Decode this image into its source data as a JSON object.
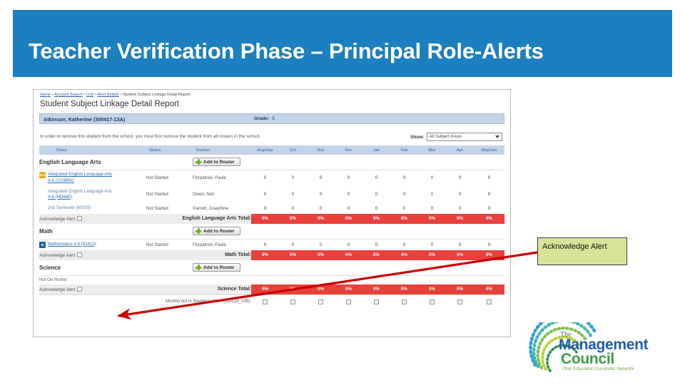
{
  "slide": {
    "title": "Teacher Verification Phase – Principal Role-Alerts",
    "banner_color": "#1c7fc0"
  },
  "screenshot": {
    "breadcrumb": {
      "items": [
        "Home",
        "Account Search",
        "Link",
        "Alert Details"
      ],
      "current": "Student Subject Linkage Detail Report",
      "separator": ">"
    },
    "report_title": "Student Subject Linkage Detail Report",
    "student": {
      "name": "Atkinson, Katherine (300417-13A)",
      "grade_label": "Grade:",
      "grade_value": "5"
    },
    "notice": "In order to remove this student from the school, you must first remove the student from all rosters in the school.",
    "show": {
      "label": "Show:",
      "value": "All Subject Areas"
    },
    "columns": [
      "Class",
      "Status",
      "Teacher",
      "Aug/Sep",
      "Oct",
      "Nov",
      "Dec",
      "Jan",
      "Feb",
      "Mar",
      "Apr",
      "May/Jun"
    ],
    "add_to_roster_label": "Add to Roster",
    "acknowledge_alert_label": "Acknowledge Alert",
    "not_on_roster_label": "Not On Roster",
    "groups": [
      {
        "name": "English Language Arts",
        "badge": "ELA",
        "badge_color": "#e2b11d",
        "rows": [
          {
            "class_line1": "Integrated English Language Arts",
            "class_line2": "4-6 (2108RA)",
            "status": "Not Started",
            "teacher": "Fitzpatrick, Paula",
            "values": [
              "0",
              "0",
              "0",
              "0",
              "0",
              "0",
              "0",
              "0",
              "0"
            ],
            "badge": "ELA",
            "linked": true
          },
          {
            "class_line1": "Integrated English Language Arts",
            "class_line2": "4-6 (HD66E)",
            "status": "Not Started",
            "teacher": "Owen, Neil",
            "values": [
              "0",
              "0",
              "0",
              "0",
              "0",
              "0",
              "0",
              "0",
              "0"
            ],
            "badge": "",
            "linked": false
          },
          {
            "class_line1": "2nd Semester (65025)",
            "class_line2": "",
            "status": "Not Started",
            "teacher": "Garrett, Josephine",
            "values": [
              "0",
              "0",
              "0",
              "0",
              "0",
              "0",
              "0",
              "0",
              "0"
            ],
            "badge": "",
            "linked": false
          }
        ],
        "total_label": "English Language Arts Total:",
        "total_values": [
          "0%",
          "0%",
          "0%",
          "0%",
          "0%",
          "0%",
          "0%",
          "0%",
          "0%"
        ]
      },
      {
        "name": "Math",
        "badge": "M",
        "badge_color": "#1f5fa8",
        "rows": [
          {
            "class_line1": "Mathematics 4-6 (91810)",
            "class_line2": "",
            "status": "Not Started",
            "teacher": "Fitzpatrick, Paula",
            "values": [
              "0",
              "0",
              "0",
              "0",
              "0",
              "0",
              "0",
              "0",
              "0"
            ],
            "badge": "M",
            "linked": true
          }
        ],
        "total_label": "Math Total:",
        "total_values": [
          "0%",
          "0%",
          "0%",
          "0%",
          "0%",
          "0%",
          "0%",
          "0%",
          "0%"
        ]
      },
      {
        "name": "Science",
        "badge": "",
        "badge_color": "",
        "rows": [],
        "total_label": "Science Total:",
        "total_values": [
          "0%",
          "0%",
          "0%",
          "0%",
          "0%",
          "0%",
          "0%",
          "0%",
          "0%"
        ]
      }
    ],
    "footer": {
      "label": "Months not in Singleton Elem (DD13A_105):",
      "checkbox_count": 9
    },
    "total_color": "#e8413c"
  },
  "callout": {
    "text": "Acknowledge Alert",
    "fill": "#d6e49a",
    "arrow_color": "#cc0000"
  },
  "logo": {
    "the": "The",
    "management": "Management",
    "council": "Council",
    "tagline": "Ohio Education Computer Network",
    "blue": "#1f5fa8",
    "green": "#3d9a4a"
  }
}
